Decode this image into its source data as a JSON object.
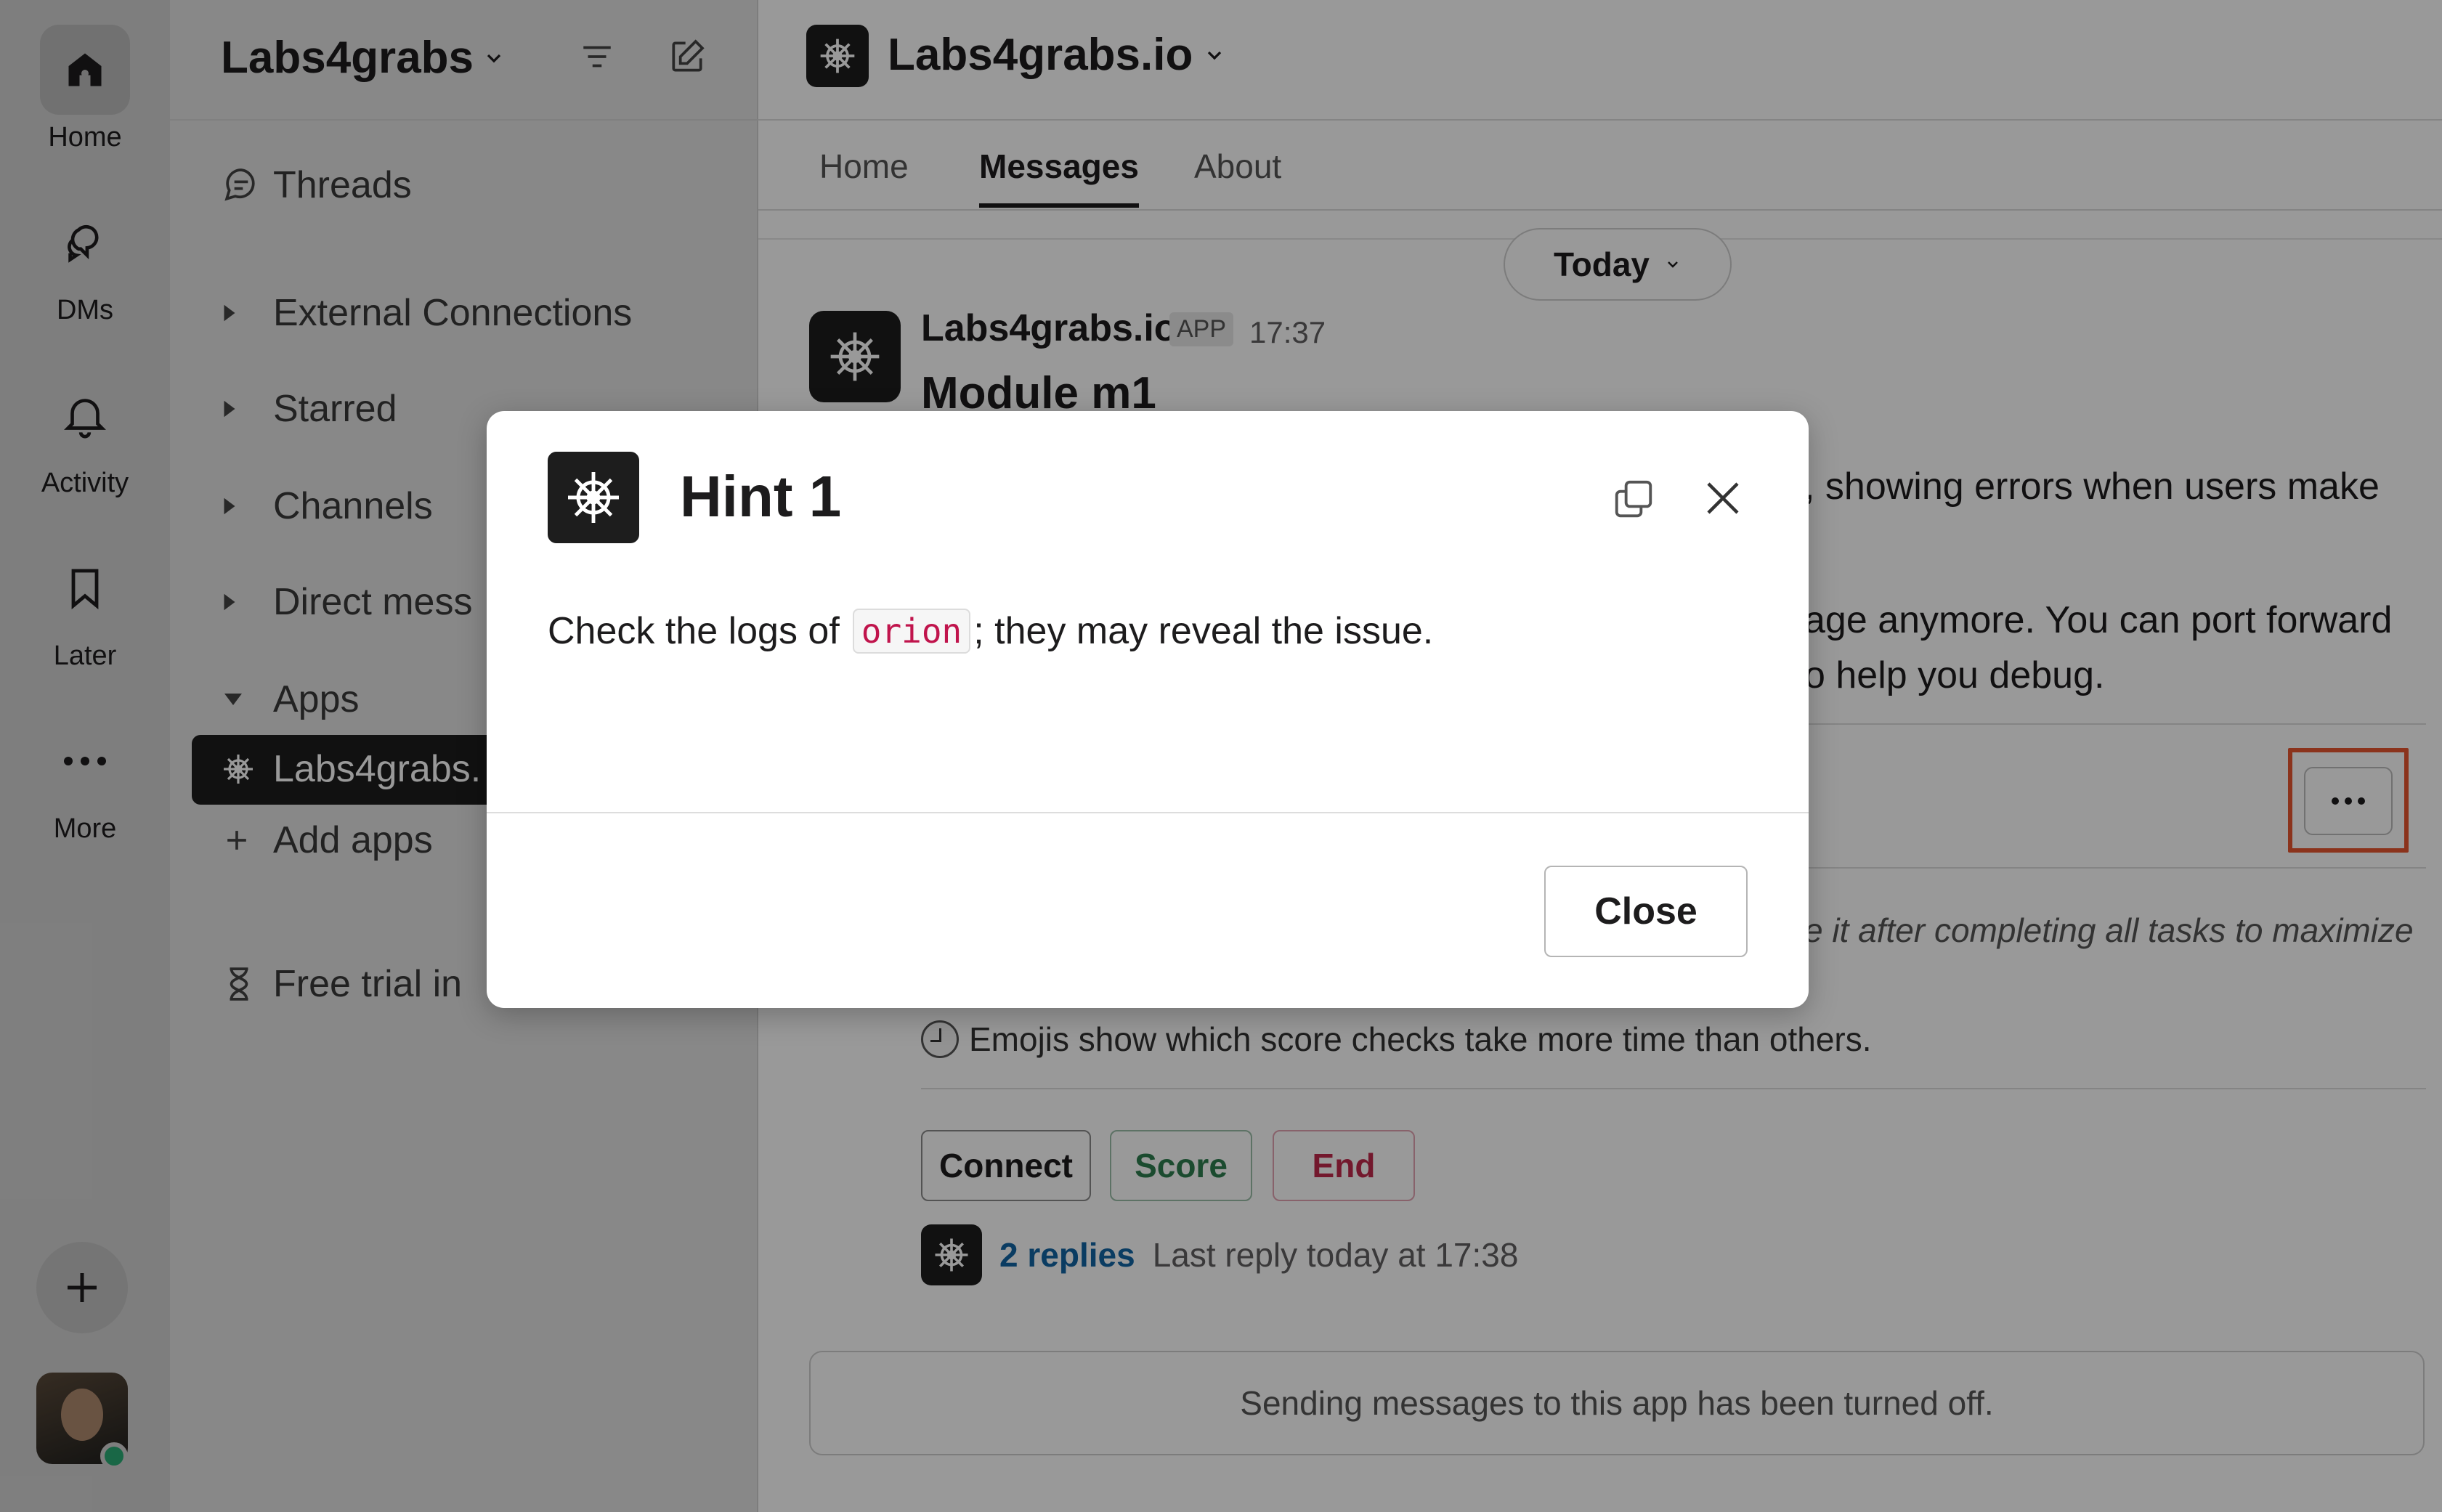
{
  "rail": {
    "items": [
      {
        "label": "Home",
        "icon": "home-icon"
      },
      {
        "label": "DMs",
        "icon": "dms-icon"
      },
      {
        "label": "Activity",
        "icon": "bell-icon"
      },
      {
        "label": "Later",
        "icon": "bookmark-icon"
      },
      {
        "label": "More",
        "icon": "more-icon"
      }
    ],
    "add_icon": "plus-icon"
  },
  "sidebar": {
    "workspace_name": "Labs4grabs",
    "items": {
      "threads": "Threads",
      "external": "External Connections",
      "starred": "Starred",
      "channels": "Channels",
      "direct": "Direct mess",
      "apps": "Apps",
      "labs_app": "Labs4grabs.",
      "add_apps": "Add apps",
      "free_trial": "Free trial in"
    }
  },
  "channel": {
    "name": "Labs4grabs.io",
    "tabs": [
      "Home",
      "Messages",
      "About"
    ],
    "active_tab": "Messages"
  },
  "timeline": {
    "date_pill": "Today"
  },
  "message": {
    "sender": "Labs4grabs.io",
    "badge": "APP",
    "time": "17:37",
    "title": "Module m1",
    "line1_fragment": ", showing errors when users make",
    "line2_fragment": "age anymore. You can port forward",
    "line3_fragment": "o help you debug.",
    "italic_fragment": "e it after completing all tasks to maximize",
    "emoji_note": "Emojis show which score checks take more time than others.",
    "buttons": {
      "connect": "Connect",
      "score": "Score",
      "end": "End"
    },
    "replies": {
      "count": "2 replies",
      "meta": "Last reply today at 17:38"
    },
    "disabled_notice": "Sending messages to this app has been turned off."
  },
  "modal": {
    "title": "Hint 1",
    "body_prefix": "Check the logs of",
    "code": "orion",
    "body_suffix": "; they may reveal the issue.",
    "close_label": "Close"
  },
  "colors": {
    "highlight": "#e8562f",
    "score_green": "#2e7d4f",
    "end_red": "#c0284b",
    "link_blue": "#1264a3"
  }
}
